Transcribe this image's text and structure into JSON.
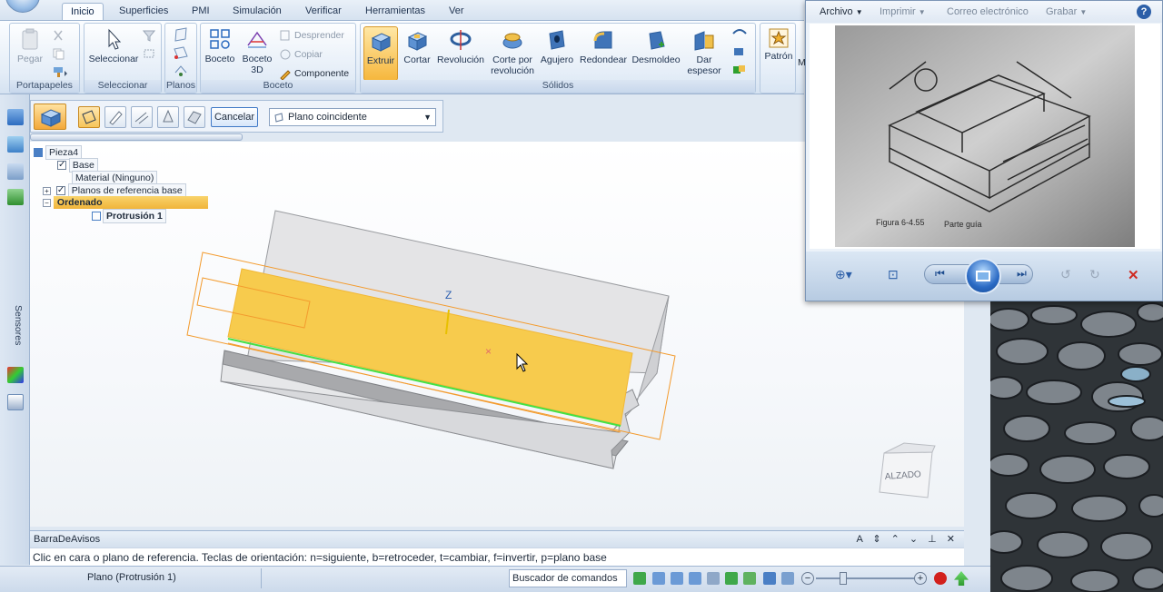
{
  "ribbon": {
    "tabs": [
      "Inicio",
      "Superficies",
      "PMI",
      "Simulación",
      "Verificar",
      "Herramientas",
      "Ver"
    ],
    "groups": {
      "portapapeles": {
        "label": "Portapapeles",
        "paste": "Pegar"
      },
      "seleccionar": {
        "label": "Seleccionar",
        "select": "Seleccionar"
      },
      "planos": {
        "label": "Planos"
      },
      "boceto": {
        "label": "Boceto",
        "sketch": "Boceto",
        "sketch3d_1": "Boceto",
        "sketch3d_2": "3D",
        "detach": "Desprender",
        "copy": "Copiar",
        "component": "Componente"
      },
      "solidos": {
        "label": "Sólidos",
        "extrude": "Extruir",
        "cut": "Cortar",
        "revolve": "Revolución",
        "revcut_1": "Corte por",
        "revcut_2": "revolución",
        "hole": "Agujero",
        "round": "Redondear",
        "draft": "Desmoldeo",
        "thicken_1": "Dar",
        "thicken_2": "espesor"
      },
      "patron": {
        "label": "Patrón",
        "extra": "M"
      }
    }
  },
  "command_bar": {
    "cancel": "Cancelar",
    "plane_option": "Plano coincidente"
  },
  "tree": {
    "root": "Pieza4",
    "base": "Base",
    "material": "Material (Ninguno)",
    "ref_planes": "Planos de referencia base",
    "ordered": "Ordenado",
    "protrusion": "Protrusión 1"
  },
  "left_bar": {
    "sensors": "Sensores"
  },
  "viewport": {
    "axis_label": "Z",
    "view_cube_label": "ALZADO"
  },
  "notify": {
    "title": "BarraDeAvisos",
    "message": "Clic en cara o plano de referencia. Teclas de orientación: n=siguiente, b=retroceder, t=cambiar, f=invertir, p=plano base"
  },
  "status": {
    "plane": "Plano (Protrusión 1)",
    "command_finder": "Buscador de comandos"
  },
  "viewer": {
    "menu": {
      "archivo": "Archivo",
      "imprimir": "Imprimir",
      "correo": "Correo electrónico",
      "grabar": "Grabar"
    }
  },
  "colors": {
    "accent": "#f7cb4d",
    "selection": "#f39b2e",
    "ribbon": "#dfe8f2"
  }
}
